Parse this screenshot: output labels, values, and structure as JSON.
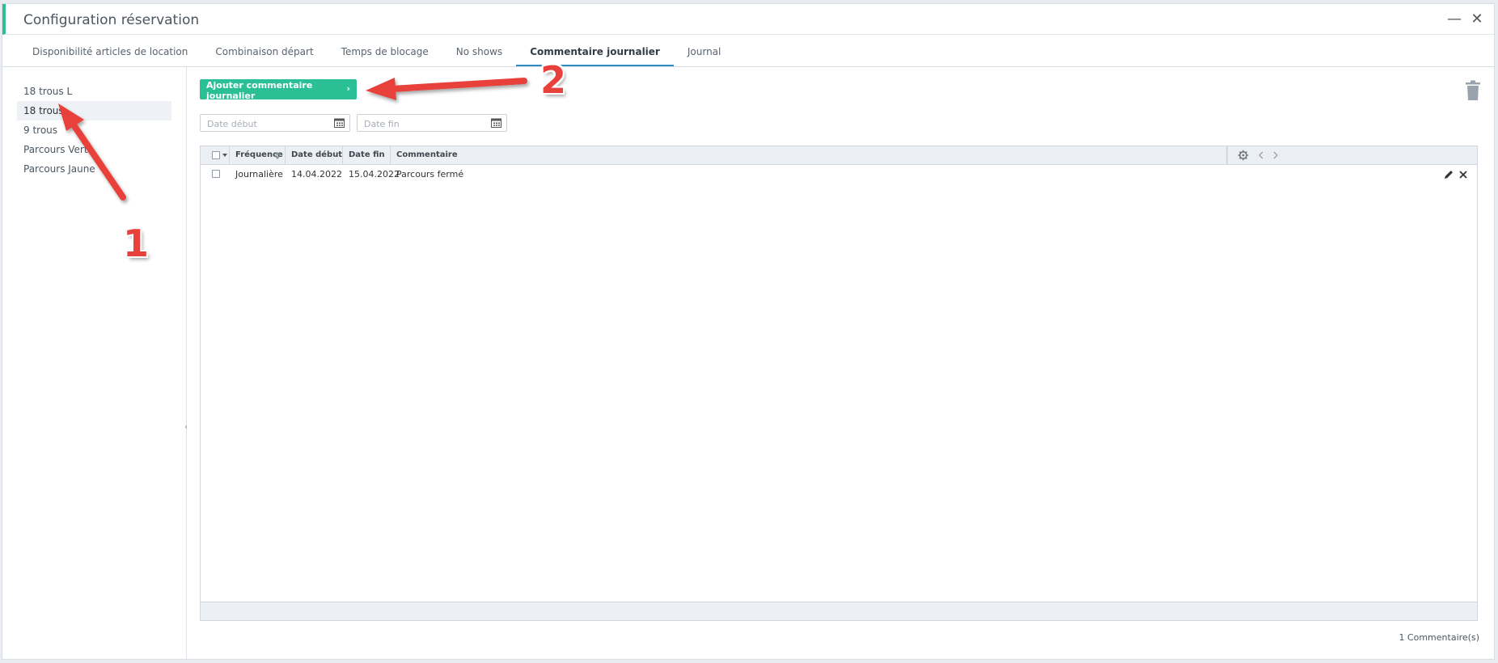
{
  "window": {
    "title": "Configuration réservation",
    "minimize_glyph": "—",
    "close_glyph": "✕"
  },
  "tabs": [
    {
      "label": "Disponibilité articles de location",
      "active": false
    },
    {
      "label": "Combinaison départ",
      "active": false
    },
    {
      "label": "Temps de blocage",
      "active": false
    },
    {
      "label": "No shows",
      "active": false
    },
    {
      "label": "Commentaire journalier",
      "active": true
    },
    {
      "label": "Journal",
      "active": false
    }
  ],
  "sidebar": {
    "items": [
      {
        "label": "18 trous L",
        "active": false
      },
      {
        "label": "18 trous",
        "active": true
      },
      {
        "label": "9 trous",
        "active": false
      },
      {
        "label": "Parcours Vert",
        "active": false
      },
      {
        "label": "Parcours Jaune",
        "active": false
      }
    ],
    "collapse_glyph": "‹"
  },
  "toolbar": {
    "add_label": "Ajouter commentaire journalier",
    "add_chevron": "›",
    "delete_icon": "trash-icon"
  },
  "filters": {
    "start_placeholder": "Date début",
    "end_placeholder": "Date fin",
    "start_value": "",
    "end_value": ""
  },
  "table": {
    "columns": [
      "Fréquence",
      "Date début",
      "Date fin",
      "Commentaire"
    ],
    "rows": [
      {
        "frequency": "Journalière",
        "start": "14.04.2022",
        "end": "15.04.2022",
        "comment": "Parcours fermé"
      }
    ]
  },
  "status": {
    "count_text": "1 Commentaire(s)"
  },
  "annotations": {
    "step1": "1",
    "step2": "2"
  },
  "colors": {
    "accent": "#2bbf96",
    "active_tab_underline": "#2e8bc0",
    "annotation_red": "#e8403a"
  }
}
